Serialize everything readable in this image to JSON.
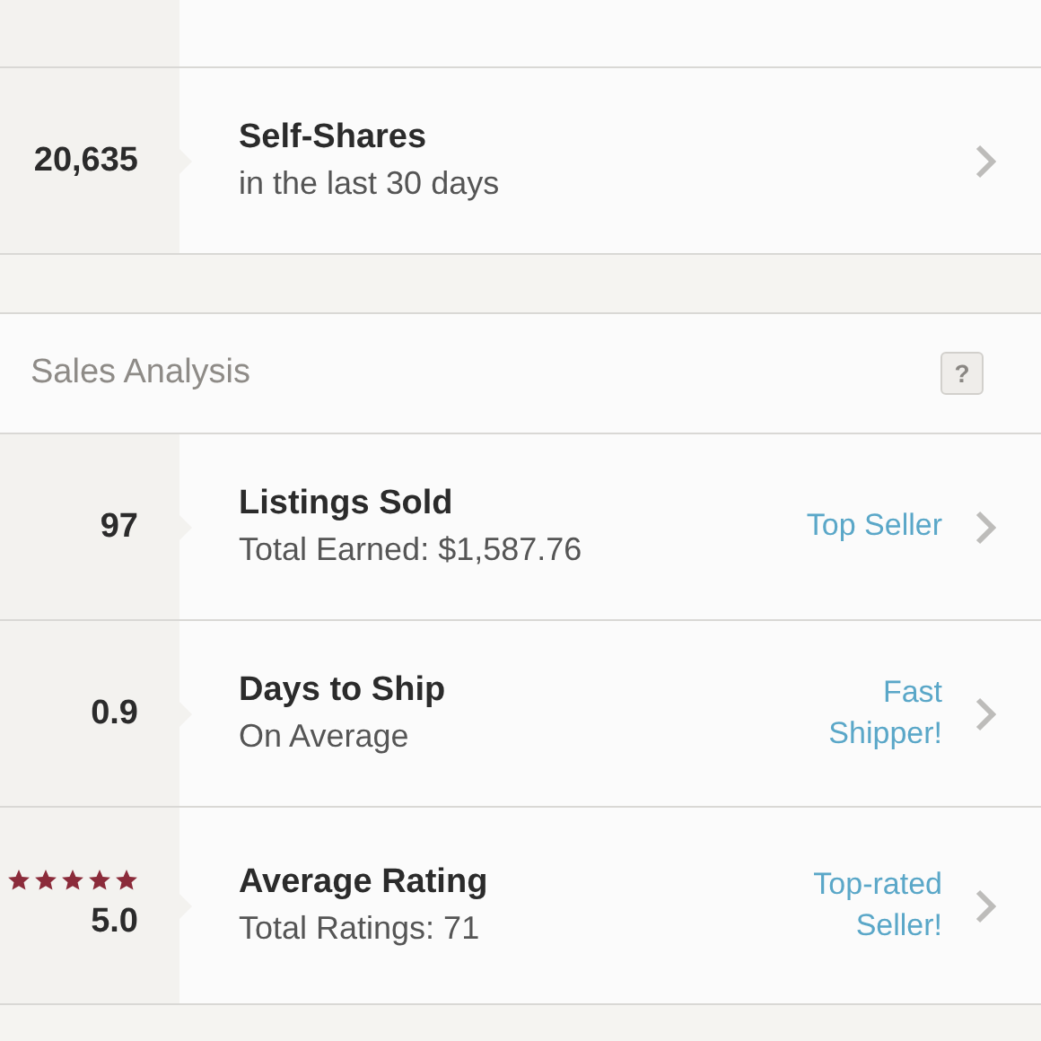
{
  "top_stats": [
    {
      "kind": "number",
      "value": "20,635",
      "title": "Self-Shares",
      "subtitle": "in the last 30 days"
    }
  ],
  "sales_analysis": {
    "title": "Sales Analysis",
    "help": "?",
    "rows": [
      {
        "kind": "number",
        "value": "97",
        "title": "Listings Sold",
        "subtitle": "Total Earned: $1,587.76",
        "badge": "Top Seller"
      },
      {
        "kind": "number",
        "value": "0.9",
        "title": "Days to Ship",
        "subtitle": "On Average",
        "badge": "Fast Shipper!"
      },
      {
        "kind": "rating",
        "stars": 5,
        "value": "5.0",
        "title": "Average Rating",
        "subtitle": "Total Ratings: 71",
        "badge": "Top-rated Seller!"
      }
    ]
  }
}
